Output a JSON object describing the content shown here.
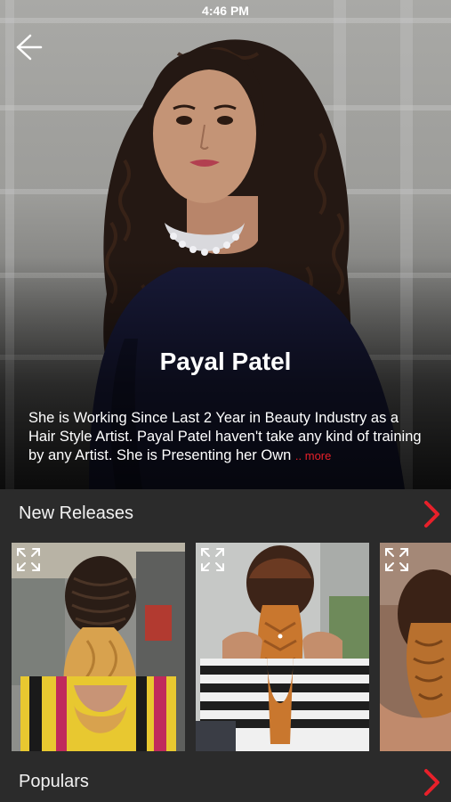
{
  "status_bar": {
    "time": "4:46 PM"
  },
  "hero": {
    "name": "Payal Patel",
    "description": "She is Working Since Last 2 Year in Beauty Industry as a Hair Style Artist. Payal Patel haven't take any kind of training by any Artist. She is Presenting her Own",
    "more_label": ".. more"
  },
  "sections": [
    {
      "title": "New Releases"
    },
    {
      "title": "Populars"
    }
  ],
  "icons": {
    "back": "arrow-left-icon",
    "chevron": "chevron-right-icon",
    "expand": "expand-icon"
  },
  "colors": {
    "accent": "#e8202a",
    "background": "#2b2b2b",
    "text": "#ffffff"
  }
}
